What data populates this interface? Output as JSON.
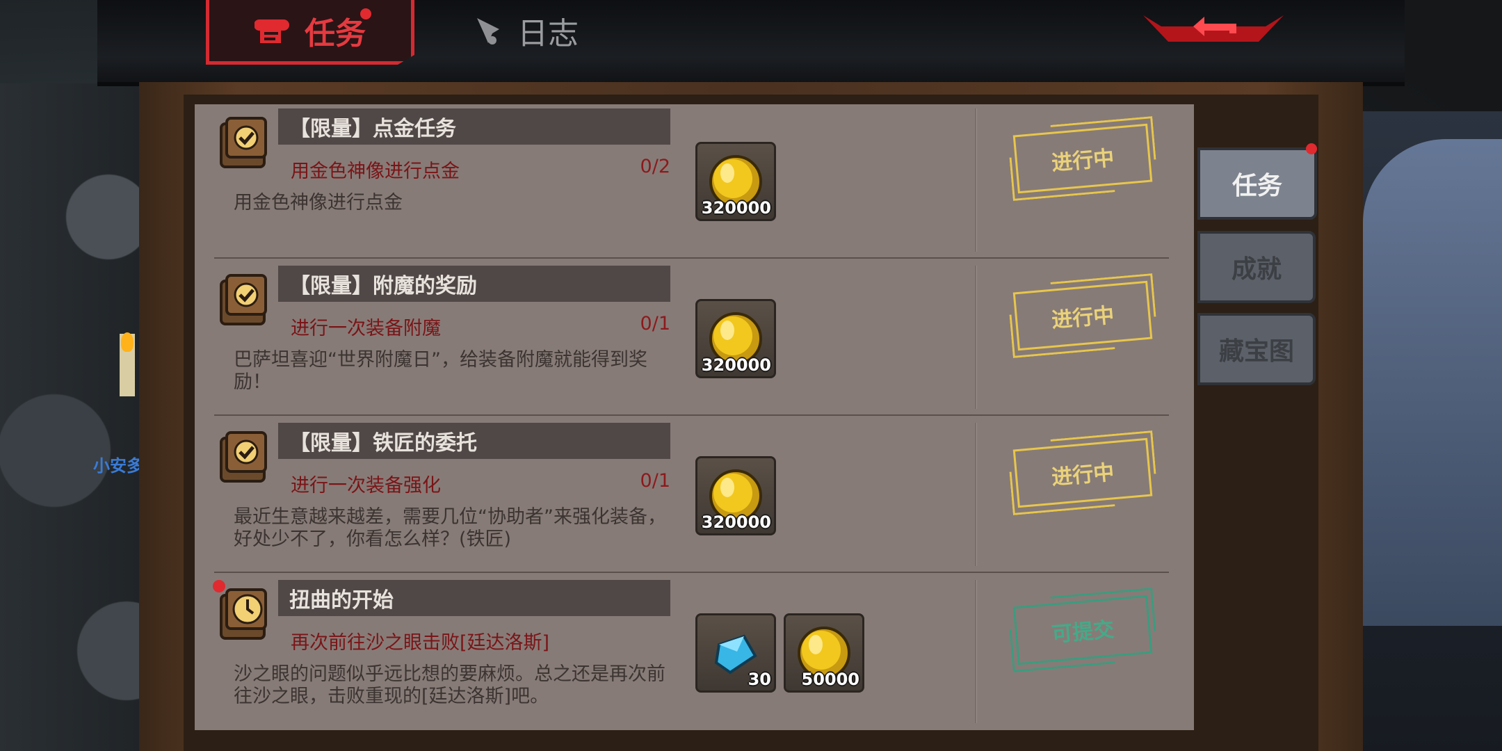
{
  "header": {
    "tabs": [
      {
        "label": "任务",
        "active": true,
        "icon": "scroll-icon",
        "has_dot": true
      },
      {
        "label": "日志",
        "active": false,
        "icon": "quill-icon"
      }
    ],
    "back_icon": "back-arrow-icon"
  },
  "npc": {
    "name": "小安多"
  },
  "quests": [
    {
      "title": "【限量】点金任务",
      "objective": "用金色神像进行点金",
      "progress": "0/2",
      "description": "用金色神像进行点金",
      "rewards": [
        {
          "type": "coin",
          "amount": "320000"
        }
      ],
      "status": "进行中",
      "icon": "quest-book-icon"
    },
    {
      "title": "【限量】附魔的奖励",
      "objective": "进行一次装备附魔",
      "progress": "0/1",
      "description": "巴萨坦喜迎“世界附魔日”，给装备附魔就能得到奖励！",
      "rewards": [
        {
          "type": "coin",
          "amount": "320000"
        }
      ],
      "status": "进行中",
      "icon": "quest-book-icon"
    },
    {
      "title": "【限量】铁匠的委托",
      "objective": "进行一次装备强化",
      "progress": "0/1",
      "description": "最近生意越来越差，需要几位“协助者”来强化装备，好处少不了，你看怎么样？(铁匠)",
      "rewards": [
        {
          "type": "coin",
          "amount": "320000"
        }
      ],
      "status": "进行中",
      "icon": "quest-book-icon"
    },
    {
      "title": "扭曲的开始",
      "objective": "再次前往沙之眼击败[廷达洛斯]",
      "progress": "",
      "description": "沙之眼的问题似乎远比想的要麻烦。总之还是再次前往沙之眼，击败重现的[廷达洛斯]吧。",
      "rewards": [
        {
          "type": "crystal",
          "amount": "30"
        },
        {
          "type": "coin",
          "amount": "50000"
        }
      ],
      "status": "可提交",
      "icon": "clock-book-icon",
      "has_dot": true
    }
  ],
  "side_tabs": [
    {
      "label": "任务",
      "active": true,
      "has_dot": true
    },
    {
      "label": "成就",
      "active": false
    },
    {
      "label": "藏宝图",
      "active": false
    }
  ],
  "colors": {
    "accent_red": "#d42a31",
    "in_progress": "#e7c64d",
    "submittable": "#3d9b7e",
    "objective": "#7a1417"
  }
}
